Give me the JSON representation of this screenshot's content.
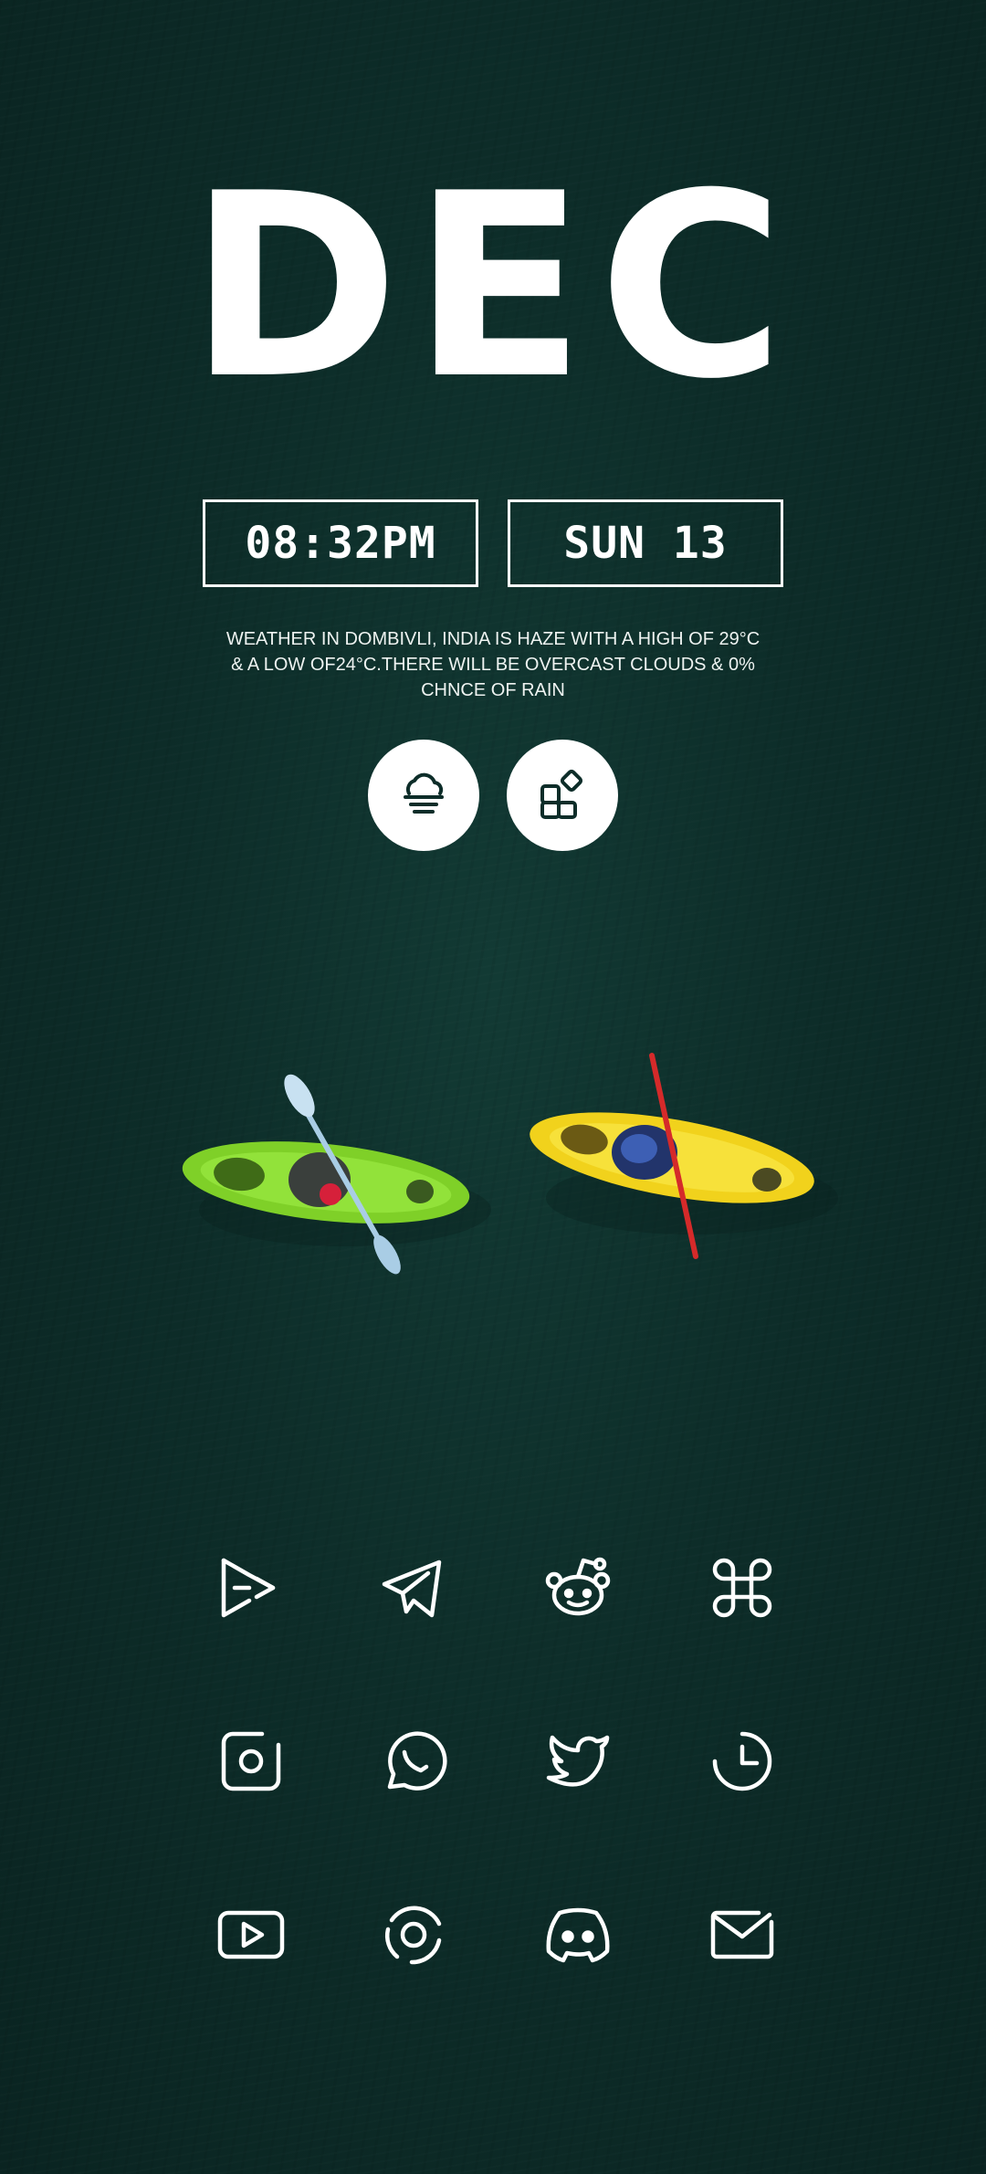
{
  "month": "DEC",
  "time": "08:32PM",
  "date": "SUN 13",
  "weather_text": "WEATHER IN DOMBIVLI, INDIA IS HAZE WITH A HIGH OF 29°C & A LOW OF24°C.THERE WILL BE OVERCAST CLOUDS & 0% CHNCE OF RAIN",
  "quick_buttons": [
    "weather-haze-icon",
    "widgets-icon"
  ],
  "apps": [
    [
      "play-store-icon",
      "telegram-icon",
      "reddit-icon",
      "command-icon"
    ],
    [
      "camera-icon",
      "whatsapp-icon",
      "twitter-icon",
      "clock-icon"
    ],
    [
      "youtube-icon",
      "chrome-icon",
      "discord-icon",
      "mail-icon"
    ]
  ],
  "colors": {
    "background": "#0d2d29",
    "foreground": "#ffffff",
    "kayak_green": "#7fd028",
    "kayak_yellow": "#f1d21c"
  }
}
